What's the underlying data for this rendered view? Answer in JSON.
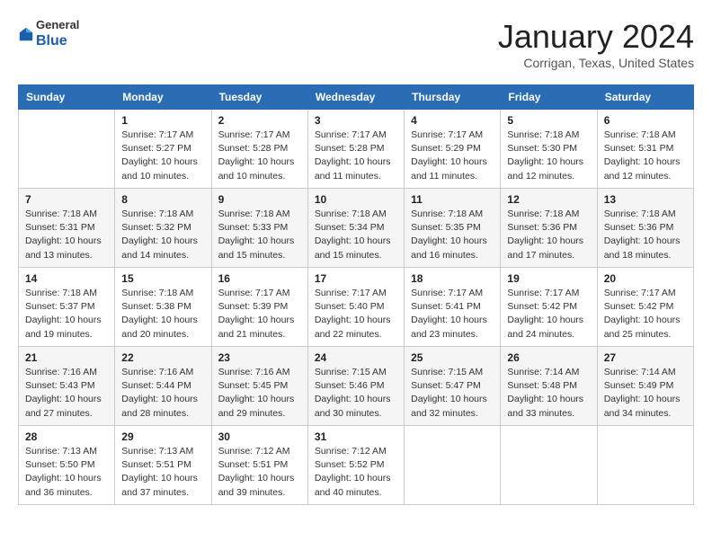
{
  "header": {
    "logo": {
      "general": "General",
      "blue": "Blue"
    },
    "title": "January 2024",
    "location": "Corrigan, Texas, United States"
  },
  "days_of_week": [
    "Sunday",
    "Monday",
    "Tuesday",
    "Wednesday",
    "Thursday",
    "Friday",
    "Saturday"
  ],
  "weeks": [
    [
      {
        "day": "",
        "detail": ""
      },
      {
        "day": "1",
        "detail": "Sunrise: 7:17 AM\nSunset: 5:27 PM\nDaylight: 10 hours\nand 10 minutes."
      },
      {
        "day": "2",
        "detail": "Sunrise: 7:17 AM\nSunset: 5:28 PM\nDaylight: 10 hours\nand 10 minutes."
      },
      {
        "day": "3",
        "detail": "Sunrise: 7:17 AM\nSunset: 5:28 PM\nDaylight: 10 hours\nand 11 minutes."
      },
      {
        "day": "4",
        "detail": "Sunrise: 7:17 AM\nSunset: 5:29 PM\nDaylight: 10 hours\nand 11 minutes."
      },
      {
        "day": "5",
        "detail": "Sunrise: 7:18 AM\nSunset: 5:30 PM\nDaylight: 10 hours\nand 12 minutes."
      },
      {
        "day": "6",
        "detail": "Sunrise: 7:18 AM\nSunset: 5:31 PM\nDaylight: 10 hours\nand 12 minutes."
      }
    ],
    [
      {
        "day": "7",
        "detail": "Sunrise: 7:18 AM\nSunset: 5:31 PM\nDaylight: 10 hours\nand 13 minutes."
      },
      {
        "day": "8",
        "detail": "Sunrise: 7:18 AM\nSunset: 5:32 PM\nDaylight: 10 hours\nand 14 minutes."
      },
      {
        "day": "9",
        "detail": "Sunrise: 7:18 AM\nSunset: 5:33 PM\nDaylight: 10 hours\nand 15 minutes."
      },
      {
        "day": "10",
        "detail": "Sunrise: 7:18 AM\nSunset: 5:34 PM\nDaylight: 10 hours\nand 15 minutes."
      },
      {
        "day": "11",
        "detail": "Sunrise: 7:18 AM\nSunset: 5:35 PM\nDaylight: 10 hours\nand 16 minutes."
      },
      {
        "day": "12",
        "detail": "Sunrise: 7:18 AM\nSunset: 5:36 PM\nDaylight: 10 hours\nand 17 minutes."
      },
      {
        "day": "13",
        "detail": "Sunrise: 7:18 AM\nSunset: 5:36 PM\nDaylight: 10 hours\nand 18 minutes."
      }
    ],
    [
      {
        "day": "14",
        "detail": "Sunrise: 7:18 AM\nSunset: 5:37 PM\nDaylight: 10 hours\nand 19 minutes."
      },
      {
        "day": "15",
        "detail": "Sunrise: 7:18 AM\nSunset: 5:38 PM\nDaylight: 10 hours\nand 20 minutes."
      },
      {
        "day": "16",
        "detail": "Sunrise: 7:17 AM\nSunset: 5:39 PM\nDaylight: 10 hours\nand 21 minutes."
      },
      {
        "day": "17",
        "detail": "Sunrise: 7:17 AM\nSunset: 5:40 PM\nDaylight: 10 hours\nand 22 minutes."
      },
      {
        "day": "18",
        "detail": "Sunrise: 7:17 AM\nSunset: 5:41 PM\nDaylight: 10 hours\nand 23 minutes."
      },
      {
        "day": "19",
        "detail": "Sunrise: 7:17 AM\nSunset: 5:42 PM\nDaylight: 10 hours\nand 24 minutes."
      },
      {
        "day": "20",
        "detail": "Sunrise: 7:17 AM\nSunset: 5:42 PM\nDaylight: 10 hours\nand 25 minutes."
      }
    ],
    [
      {
        "day": "21",
        "detail": "Sunrise: 7:16 AM\nSunset: 5:43 PM\nDaylight: 10 hours\nand 27 minutes."
      },
      {
        "day": "22",
        "detail": "Sunrise: 7:16 AM\nSunset: 5:44 PM\nDaylight: 10 hours\nand 28 minutes."
      },
      {
        "day": "23",
        "detail": "Sunrise: 7:16 AM\nSunset: 5:45 PM\nDaylight: 10 hours\nand 29 minutes."
      },
      {
        "day": "24",
        "detail": "Sunrise: 7:15 AM\nSunset: 5:46 PM\nDaylight: 10 hours\nand 30 minutes."
      },
      {
        "day": "25",
        "detail": "Sunrise: 7:15 AM\nSunset: 5:47 PM\nDaylight: 10 hours\nand 32 minutes."
      },
      {
        "day": "26",
        "detail": "Sunrise: 7:14 AM\nSunset: 5:48 PM\nDaylight: 10 hours\nand 33 minutes."
      },
      {
        "day": "27",
        "detail": "Sunrise: 7:14 AM\nSunset: 5:49 PM\nDaylight: 10 hours\nand 34 minutes."
      }
    ],
    [
      {
        "day": "28",
        "detail": "Sunrise: 7:13 AM\nSunset: 5:50 PM\nDaylight: 10 hours\nand 36 minutes."
      },
      {
        "day": "29",
        "detail": "Sunrise: 7:13 AM\nSunset: 5:51 PM\nDaylight: 10 hours\nand 37 minutes."
      },
      {
        "day": "30",
        "detail": "Sunrise: 7:12 AM\nSunset: 5:51 PM\nDaylight: 10 hours\nand 39 minutes."
      },
      {
        "day": "31",
        "detail": "Sunrise: 7:12 AM\nSunset: 5:52 PM\nDaylight: 10 hours\nand 40 minutes."
      },
      {
        "day": "",
        "detail": ""
      },
      {
        "day": "",
        "detail": ""
      },
      {
        "day": "",
        "detail": ""
      }
    ]
  ]
}
